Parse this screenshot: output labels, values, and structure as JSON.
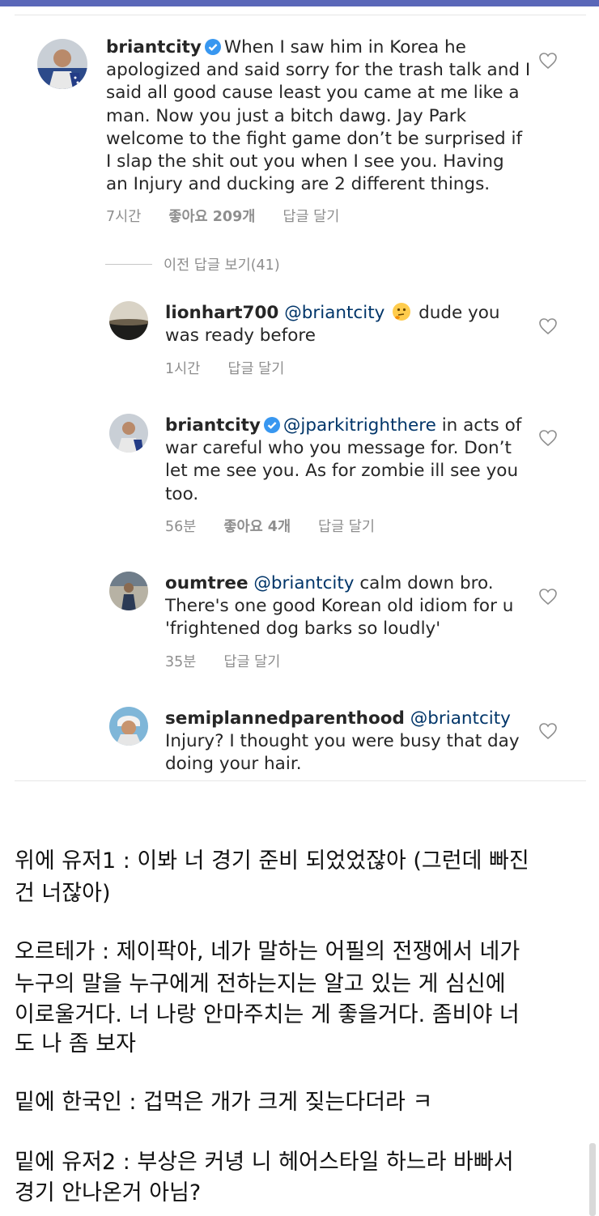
{
  "comments": [
    {
      "username": "briantcity",
      "verified": true,
      "text": "When I saw him in Korea he apologized and said sorry for the  trash talk and I said all good cause least you came at me like a man. Now you just a bitch dawg. Jay Park welcome to the fight game don’t be surprised if I slap the shit out you when I see you. Having an Injury and ducking are 2 different things.",
      "time": "7시간",
      "likes": "좋아요 209개",
      "reply": "답글 달기"
    }
  ],
  "view_replies": "이전 답글 보기(41)",
  "replies": [
    {
      "username": "lionhart700",
      "mention": "@briantcity",
      "emoji": "thinking-face",
      "text": "dude you was ready before",
      "time": "1시간",
      "reply": "답글 달기"
    },
    {
      "username": "briantcity",
      "verified": true,
      "mention": "@jparkitrighthere",
      "text": "in acts of war careful who you message for. Don’t let me see you. As for zombie  ill see you too.",
      "time": "56분",
      "likes": "좋아요 4개",
      "reply": "답글 달기"
    },
    {
      "username": "oumtree",
      "mention": "@briantcity",
      "text": "calm down bro. There's one good Korean old idiom for u 'frightened dog barks so loudly'",
      "time": "35분",
      "reply": "답글 달기"
    },
    {
      "username": "semiplannedparenthood",
      "mention": "@briantcity",
      "text": "Injury? I thought you were busy that day doing your hair."
    }
  ],
  "translation": {
    "p1_l1": "위에 유저1 : 이봐 너 경기 준비 되었었잖아 (그런데 빠진",
    "p1_l2": "건 너잖아)",
    "p2_l1": "오르테가 : 제이팍아, 네가 말하는 어필의 전쟁에서 네가",
    "p2_l2": "누구의 말을 누구에게 전하는지는 알고 있는 게 심신에",
    "p2_l3": "이로울거다. 너 나랑 안마주치는 게 좋을거다. 좀비야 너",
    "p2_l4": "도 나 좀 보자",
    "p3_l1": "밑에 한국인 : 겁먹은 개가 크게 짖는다더라 ㅋ",
    "p4_l1": "밑에 유저2 : 부상은 커녕 니 헤어스타일 하느라 바빠서",
    "p4_l2": "경기 안나온거 아님?"
  },
  "colors": {
    "verified": "#3897f0",
    "mention": "#003569",
    "meta": "#8e8e8e"
  }
}
